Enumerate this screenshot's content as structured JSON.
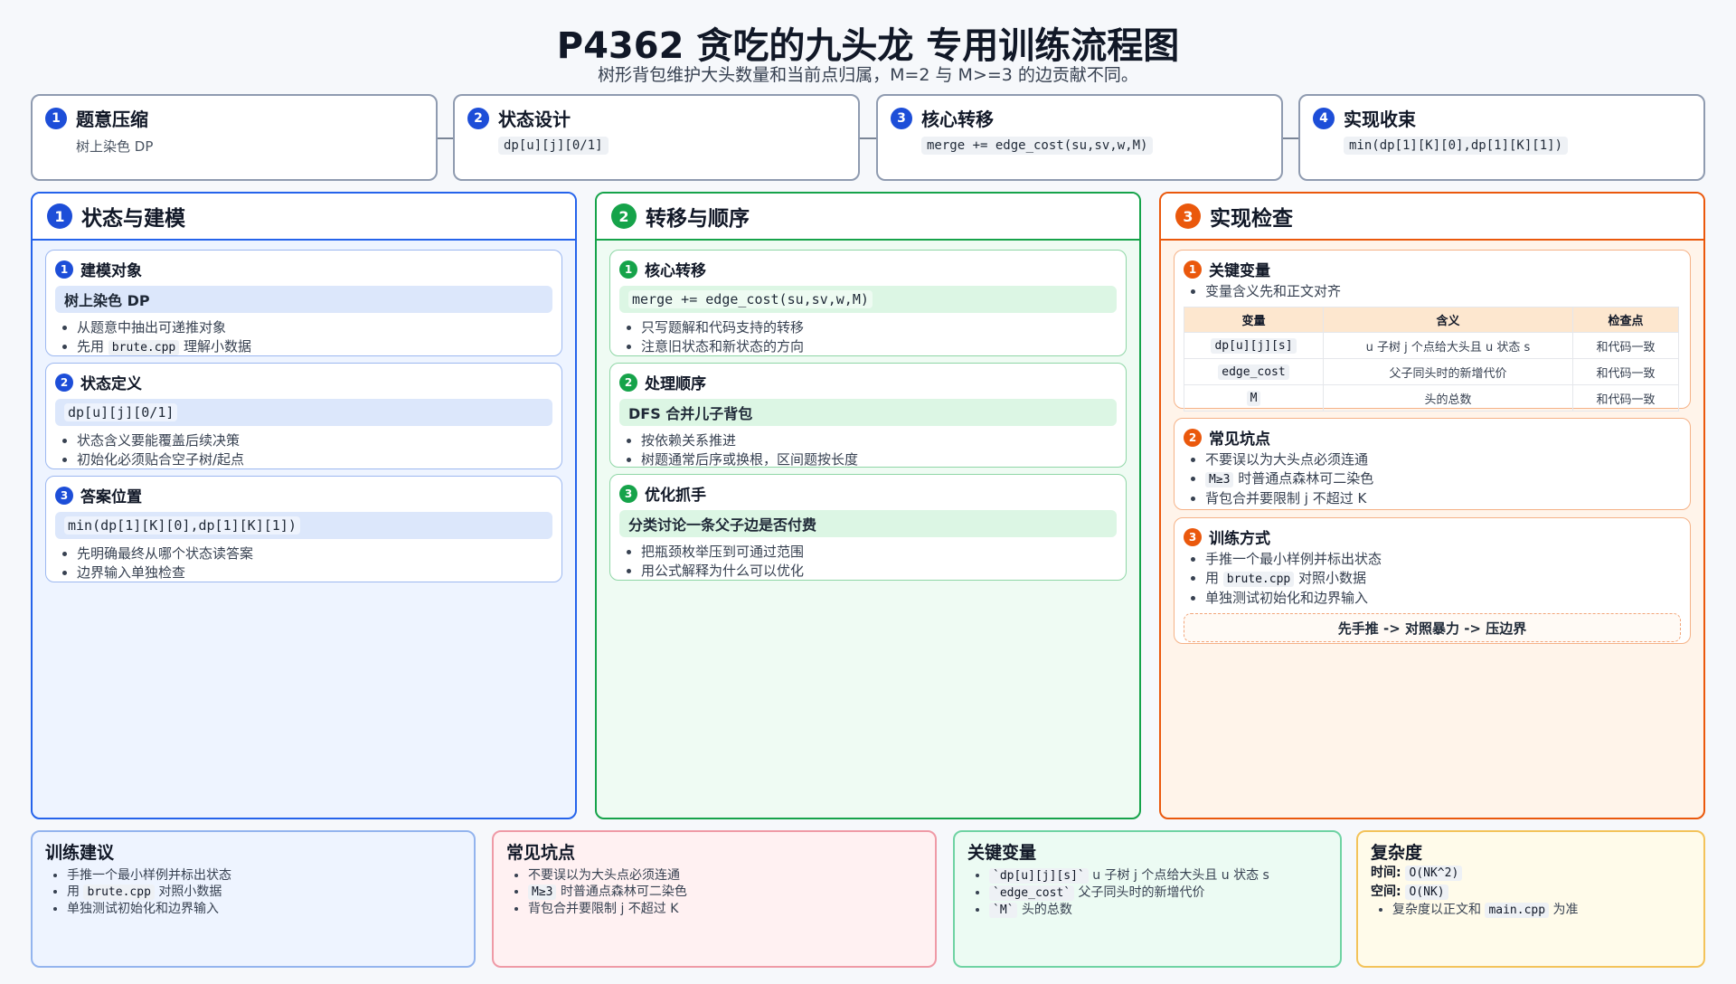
{
  "header": {
    "title": "P4362 贪吃的九头龙 专用训练流程图",
    "subtitle": "树形背包维护大头数量和当前点归属，M=2 与 M>=3 的边贡献不同。"
  },
  "flow": [
    {
      "num": "1",
      "title": "题意压缩",
      "sub": "树上染色 DP"
    },
    {
      "num": "2",
      "title": "状态设计",
      "sub": "dp[u][j][0/1]"
    },
    {
      "num": "3",
      "title": "核心转移",
      "sub": "merge += edge_cost(su,sv,w,M)"
    },
    {
      "num": "4",
      "title": "实现收束",
      "sub": "min(dp[1][K][0],dp[1][K][1])"
    }
  ],
  "columns": [
    {
      "num": "1",
      "title": "状态与建模",
      "cards": [
        {
          "num": "1",
          "title": "建模对象",
          "highlight": "树上染色 DP",
          "bullets": [
            "从题意中抽出可递推对象"
          ],
          "b2_pre": "先用",
          "b2_code": "brute.cpp",
          "b2_post": "理解小数据"
        },
        {
          "num": "2",
          "title": "状态定义",
          "highlight": "dp[u][j][0/1]",
          "bullets": [
            "状态含义要能覆盖后续决策",
            "初始化必须贴合空子树/起点"
          ]
        },
        {
          "num": "3",
          "title": "答案位置",
          "highlight": "min(dp[1][K][0],dp[1][K][1])",
          "bullets": [
            "先明确最终从哪个状态读答案",
            "边界输入单独检查"
          ]
        }
      ]
    },
    {
      "num": "2",
      "title": "转移与顺序",
      "cards": [
        {
          "num": "1",
          "title": "核心转移",
          "highlight": "merge += edge_cost(su,sv,w,M)",
          "bullets": [
            "只写题解和代码支持的转移",
            "注意旧状态和新状态的方向"
          ]
        },
        {
          "num": "2",
          "title": "处理顺序",
          "highlight": "DFS 合并儿子背包",
          "bullets": [
            "按依赖关系推进",
            "树题通常后序或换根，区间题按长度"
          ]
        },
        {
          "num": "3",
          "title": "优化抓手",
          "highlight": "分类讨论一条父子边是否付费",
          "bullets": [
            "把瓶颈枚举压到可通过范围",
            "用公式解释为什么可以优化"
          ]
        }
      ]
    },
    {
      "num": "3",
      "title": "实现检查",
      "card1": {
        "num": "1",
        "title": "关键变量",
        "bullet": "变量含义先和正文对齐",
        "table_headers": [
          "变量",
          "含义",
          "检查点"
        ],
        "table_rows": [
          [
            "dp[u][j][s]",
            "u 子树 j 个点给大头且 u 状态 s",
            "和代码一致"
          ],
          [
            "edge_cost",
            "父子同头时的新增代价",
            "和代码一致"
          ],
          [
            "M",
            "头的总数",
            "和代码一致"
          ]
        ]
      },
      "card2": {
        "num": "2",
        "title": "常见坑点",
        "b1": "不要误以为大头点必须连通",
        "b2_code": "M≥3",
        "b2_post": "时普通点森林可二染色",
        "b3": "背包合并要限制 j 不超过 K"
      },
      "card3": {
        "num": "3",
        "title": "训练方式",
        "b1": "手推一个最小样例并标出状态",
        "b2_pre": "用",
        "b2_code": "brute.cpp",
        "b2_post": "对照小数据",
        "b3": "单独测试初始化和边界输入",
        "note": "先手推 -> 对照暴力 -> 压边界"
      }
    }
  ],
  "bottom": {
    "training": {
      "title": "训练建议",
      "b1": "手推一个最小样例并标出状态",
      "b2_pre": "用",
      "b2_code": "brute.cpp",
      "b2_post": "对照小数据",
      "b3": "单独测试初始化和边界输入"
    },
    "pitfalls": {
      "title": "常见坑点",
      "b1": "不要误以为大头点必须连通",
      "b2_code": "M≥3",
      "b2_post": "时普通点森林可二染色",
      "b3": "背包合并要限制 j 不超过 K"
    },
    "vars": {
      "title": "关键变量",
      "items": [
        {
          "code": "`dp[u][j][s]`",
          "text": "u 子树 j 个点给大头且 u 状态 s"
        },
        {
          "code": "`edge_cost`",
          "text": "父子同头时的新增代价"
        },
        {
          "code": "`M`",
          "text": "头的总数"
        }
      ]
    },
    "complexity": {
      "title": "复杂度",
      "time_label": "时间:",
      "time_value": "O(NK^2)",
      "space_label": "空间:",
      "space_value": "O(NK)",
      "b_pre": "复杂度以正文和",
      "b_code": "main.cpp",
      "b_post": "为准"
    }
  },
  "colors": {
    "blue": "#2563eb",
    "green": "#16a34a",
    "orange": "#ea580c"
  }
}
